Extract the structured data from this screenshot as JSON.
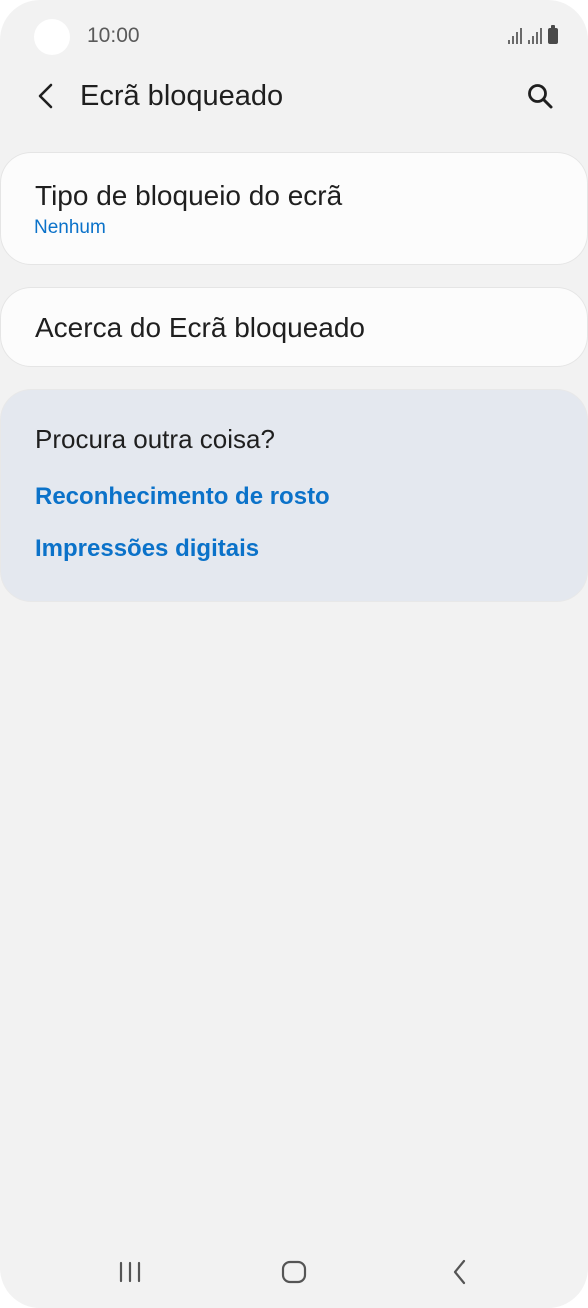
{
  "status_bar": {
    "time": "10:00",
    "icons": [
      "signal-icon",
      "signal-icon",
      "battery-icon"
    ]
  },
  "app_bar": {
    "title": "Ecrã bloqueado",
    "back_icon": "back-arrow-icon",
    "search_icon": "search-icon"
  },
  "settings": {
    "lock_type": {
      "title": "Tipo de bloqueio do ecrã",
      "value": "Nenhum"
    },
    "about": {
      "title": "Acerca do Ecrã bloqueado"
    }
  },
  "suggestions": {
    "title": "Procura outra coisa?",
    "links": [
      {
        "label": "Reconhecimento de rosto"
      },
      {
        "label": "Impressões digitais"
      }
    ]
  },
  "nav_bar": {
    "recent_icon": "recent-apps-icon",
    "home_icon": "home-icon",
    "back_icon": "back-icon"
  },
  "colors": {
    "background": "#f2f2f2",
    "card": "#fcfcfc",
    "suggestion_card": "#e4e8ef",
    "accent": "#0b72c9",
    "text": "#1f1f1f"
  }
}
